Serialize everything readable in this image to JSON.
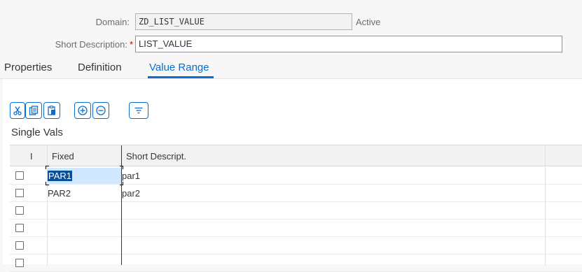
{
  "header": {
    "domain_label": "Domain:",
    "domain_value": "ZD_LIST_VALUE",
    "domain_status": "Active",
    "short_desc_label": "Short Description:",
    "short_desc_required": "*",
    "short_desc_value": "LIST_VALUE"
  },
  "tabs": [
    {
      "label": "Properties",
      "active": false
    },
    {
      "label": "Definition",
      "active": false
    },
    {
      "label": "Value Range",
      "active": true
    }
  ],
  "toolbar": {
    "icons": [
      "cut-icon",
      "copy-icon",
      "paste-icon",
      "add-row-icon",
      "remove-row-icon",
      "filter-icon"
    ],
    "accent": "#0a6ed1"
  },
  "section": {
    "title": "Single Vals"
  },
  "table": {
    "columns": [
      "I",
      "Fixed",
      "Short Descript."
    ],
    "rows": [
      {
        "fixed": "PAR1",
        "desc": "par1",
        "selected": true
      },
      {
        "fixed": "PAR2",
        "desc": "par2",
        "selected": false
      },
      {
        "fixed": "",
        "desc": "",
        "selected": false
      },
      {
        "fixed": "",
        "desc": "",
        "selected": false
      },
      {
        "fixed": "",
        "desc": "",
        "selected": false
      },
      {
        "fixed": "",
        "desc": "",
        "selected": false
      }
    ]
  }
}
